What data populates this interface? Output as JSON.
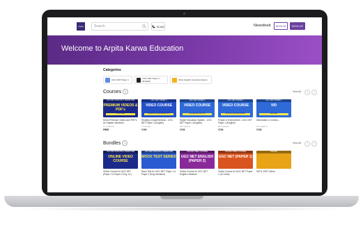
{
  "nav": {
    "logo_text": "arpita",
    "search_placeholder": "Search",
    "scan_label": "SCAN",
    "newsfeed": "Newsfeed",
    "sign_in": "SIGN IN",
    "sign_up": "SIGN UP"
  },
  "hero": {
    "title": "Welcome to Arpita Karwa Education"
  },
  "categories": {
    "label": "Categories",
    "items": [
      {
        "label": "UGC NET Paper 1",
        "color": "#5b8de0"
      },
      {
        "label": "UGC NET Paper 2 (English)",
        "color": "#222222"
      },
      {
        "label": "Other English Literature Exams",
        "color": "#f2b31a"
      }
    ]
  },
  "courses": {
    "title": "Courses",
    "count": "5",
    "view_all": "View All",
    "prev": "<",
    "next": ">",
    "items": [
      {
        "band": "UGC NET ENGLISH LITERATURE",
        "big": "PREMIUM VIDEOS & PDF's",
        "sub": "FOR FREE",
        "bg": "#1b2a8a",
        "fg": "#ffe94a",
        "sub_bg": "#ffe94a",
        "sub_fg": "#1b2a8a",
        "name": "Demo Premium Videos and PDF's for English Literature...",
        "meta": "17 Lessons",
        "price": "FREE"
      },
      {
        "band": "UGC NET PAPER 2",
        "big": "VIDEO COURSE",
        "sub": "READING COMPREHENSION",
        "bg": "#2450c8",
        "fg": "#ffffff",
        "sub_bg": "#ffe94a",
        "sub_fg": "#1b2a8a",
        "name": "Reading Comprehension - UGC NET Paper 1 (English)",
        "meta": "7 Lessons",
        "price": "₹799"
      },
      {
        "band": "UGC NET PAPER 1",
        "big": "VIDEO COURSE",
        "sub": "HIGHER EDUCATION",
        "bg": "#2f6ad8",
        "fg": "#ffffff",
        "sub_bg": "#ffe94a",
        "sub_fg": "#1b2a8a",
        "name": "Higher Education System - UGC NET Paper 1 (English)",
        "meta": "40 Lessons",
        "price": "₹799"
      },
      {
        "band": "UGC NET PAPER 1",
        "big": "VIDEO COURSE",
        "sub": "PEOPLE & ENVIRONMENT",
        "bg": "#2f6ad8",
        "fg": "#ffffff",
        "sub_bg": "#ffe94a",
        "sub_fg": "#1b2a8a",
        "name": "People & Environment - UGC NET Paper 1 (English)",
        "meta": "22 Lessons",
        "price": "₹799"
      },
      {
        "band": "UGC NET PAPER 1",
        "big": "VID",
        "sub": "INFORMA",
        "bg": "#2f6ad8",
        "fg": "#ffffff",
        "sub_bg": "#ffe94a",
        "sub_fg": "#1b2a8a",
        "name": "Information & Commu...",
        "meta": "31 Lessons",
        "price": "₹799"
      }
    ]
  },
  "bundles": {
    "title": "Bundles",
    "count": "5",
    "view_all": "View All",
    "prev": "<",
    "next": ">",
    "items": [
      {
        "band": "UGC NET ENGLISH LITERATURE",
        "big": "ONLINE VIDEO COURSE",
        "sub": "",
        "bg": "#1b2a8a",
        "fg": "#ffe94a",
        "sub_bg": "transparent",
        "sub_fg": "#ffffff",
        "name": "Online Course for UGC NET (Paper 1 & Paper 2 Eng. Lit.)",
        "meta": "",
        "price": ""
      },
      {
        "band": "UGC NET ENGLISH LITERATURE",
        "big": "MOCK TEST SERIES",
        "sub": "",
        "bg": "#2a5bd0",
        "fg": "#ffe94a",
        "sub_bg": "transparent",
        "sub_fg": "#ffffff",
        "name": "Mock Test for UGC NET Paper 1 & Paper 2 (Eng Literature)",
        "meta": "",
        "price": ""
      },
      {
        "band": "ONLINE VIDEO COURSE",
        "big": "UGC NET ENGLISH (PAPER 2)",
        "sub": "",
        "bg": "#8a2a9a",
        "fg": "#ffffff",
        "sub_bg": "transparent",
        "sub_fg": "#ffffff",
        "name": "Online Course for UGC NET English Literature",
        "meta": "",
        "price": ""
      },
      {
        "band": "ONLINE VIDEO COURSE",
        "big": "UGC NET (PAPER 1)",
        "sub": "",
        "bg": "#d9541e",
        "fg": "#ffffff",
        "sub_bg": "transparent",
        "sub_fg": "#ffffff",
        "name": "Online Course for UGC NET Paper 1 (10 Units)",
        "meta": "",
        "price": ""
      },
      {
        "band": "ONLINE",
        "big": "",
        "sub": "",
        "bg": "#e8a317",
        "fg": "#ffffff",
        "sub_bg": "transparent",
        "sub_fg": "#ffffff",
        "name": "SATS, ESE Online...",
        "meta": "",
        "price": ""
      }
    ]
  }
}
